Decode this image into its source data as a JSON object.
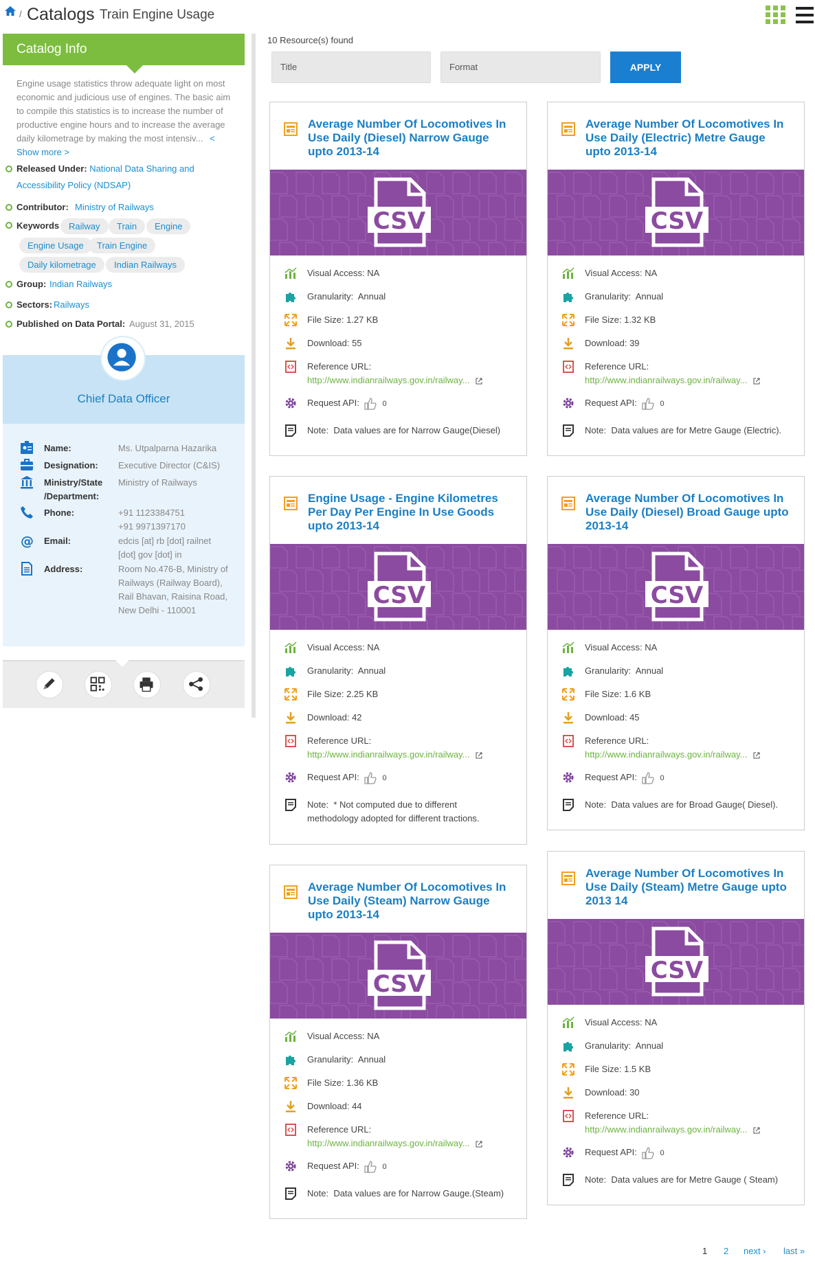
{
  "breadcrumb": {
    "sep": "/",
    "catalogs": "Catalogs",
    "current": "Train Engine Usage"
  },
  "sidebar": {
    "header": "Catalog Info",
    "description": "Engine usage statistics throw adequate light on most economic and judicious use of engines. The basic aim to compile this statistics is to increase the number of productive engine hours and to increase the average daily kilometrage by making the most intensiv...",
    "show_more": "< Show more >",
    "released_label": "Released Under:",
    "released_value_1": "National Data Sharing and",
    "released_value_2": "Accessibility Policy (NDSAP)",
    "contributor_label": "Contributor:",
    "contributor_value": "Ministry of Railways",
    "keywords_label": "Keywords",
    "keywords": [
      "Railway",
      "Train",
      "Engine",
      "Engine Usage",
      "Train Engine",
      "Daily kilometrage",
      "Indian Railways"
    ],
    "group_label": "Group:",
    "group_value": "Indian Railways",
    "sectors_label": "Sectors:",
    "sectors_value": "Railways",
    "published_label": "Published on Data Portal:",
    "published_value": "August 31, 2015"
  },
  "cdo": {
    "title": "Chief Data Officer",
    "name_label": "Name:",
    "name_value": "Ms. Utpalparna Hazarika",
    "designation_label": "Designation:",
    "designation_value": "Executive Director (C&IS)",
    "ministry_label_1": "Ministry/State",
    "ministry_label_2": "/Department:",
    "ministry_value": "Ministry of Railways",
    "phone_label": "Phone:",
    "phone_1": "+91 1123384751",
    "phone_2": "+91 9971397170",
    "email_label": "Email:",
    "email_1": "edcis [at] rb [dot] railnet",
    "email_2": "[dot] gov [dot] in",
    "address_label": "Address:",
    "address_1": "Room No.476-B, Ministry of",
    "address_2": "Railways (Railway Board),",
    "address_3": "Rail Bhavan, Raisina Road,",
    "address_4": "New Delhi - 110001"
  },
  "results": {
    "count": "10 Resource(s) found",
    "title_placeholder": "Title",
    "format_placeholder": "Format",
    "apply": "APPLY"
  },
  "card_labels": {
    "banner": "CSV",
    "visual": "Visual Access:",
    "granularity": "Granularity:",
    "filesize": "File Size:",
    "download": "Download:",
    "refurl": "Reference URL:",
    "api": "Request API:",
    "note": "Note:"
  },
  "cards": [
    {
      "title_1": "Average Number Of Locomotives In",
      "title_2": "Use Daily (Diesel) Narrow Gauge",
      "title_3": "upto 2013-14",
      "visual": "NA",
      "granularity": "Annual",
      "filesize": "1.27 KB",
      "download": "55",
      "url": "http://www.indianrailways.gov.in/railway...",
      "likes": "0",
      "note_1": "Data values are for Narrow Gauge(Diesel)",
      "note_2": ""
    },
    {
      "title_1": "Average Number Of Locomotives In",
      "title_2": "Use Daily (Electric) Metre Gauge",
      "title_3": "upto 2013-14",
      "visual": "NA",
      "granularity": "Annual",
      "filesize": "1.32 KB",
      "download": "39",
      "url": "http://www.indianrailways.gov.in/railway...",
      "likes": "0",
      "note_1": "Data values are for Metre Gauge (Electric).",
      "note_2": ""
    },
    {
      "title_1": "Engine Usage - Engine Kilometres",
      "title_2": "Per Day Per Engine In Use Goods",
      "title_3": "upto 2013-14",
      "visual": "NA",
      "granularity": "Annual",
      "filesize": "2.25 KB",
      "download": "42",
      "url": "http://www.indianrailways.gov.in/railway...",
      "likes": "0",
      "note_1": "* Not computed due to different",
      "note_2": "methodology adopted for different tractions."
    },
    {
      "title_1": "Average Number Of Locomotives In",
      "title_2": "Use Daily (Diesel) Broad Gauge upto",
      "title_3": "2013-14",
      "visual": "NA",
      "granularity": "Annual",
      "filesize": "1.6 KB",
      "download": "45",
      "url": "http://www.indianrailways.gov.in/railway...",
      "likes": "0",
      "note_1": "Data values are for Broad Gauge( Diesel).",
      "note_2": ""
    },
    {
      "title_1": "Average Number Of Locomotives In",
      "title_2": "Use Daily (Steam) Narrow Gauge",
      "title_3": "upto 2013-14",
      "visual": "NA",
      "granularity": "Annual",
      "filesize": "1.36 KB",
      "download": "44",
      "url": "http://www.indianrailways.gov.in/railway...",
      "likes": "0",
      "note_1": "Data values are for Narrow Gauge.(Steam)",
      "note_2": ""
    },
    {
      "title_1": "Average Number Of Locomotives In",
      "title_2": "Use Daily (Steam) Metre Gauge upto",
      "title_3": "2013 14",
      "visual": "NA",
      "granularity": "Annual",
      "filesize": "1.5 KB",
      "download": "30",
      "url": "http://www.indianrailways.gov.in/railway...",
      "likes": "0",
      "note_1": "Data values are for Metre Gauge ( Steam)",
      "note_2": ""
    }
  ],
  "pager": {
    "p1": "1",
    "p2": "2",
    "next": "next ›",
    "last": "last »"
  },
  "colors": {
    "accent_green": "#7cbd3f",
    "link_blue": "#1a7fc4",
    "csv_purple": "#8b4ba0",
    "apply_blue": "#1a7fd1"
  }
}
